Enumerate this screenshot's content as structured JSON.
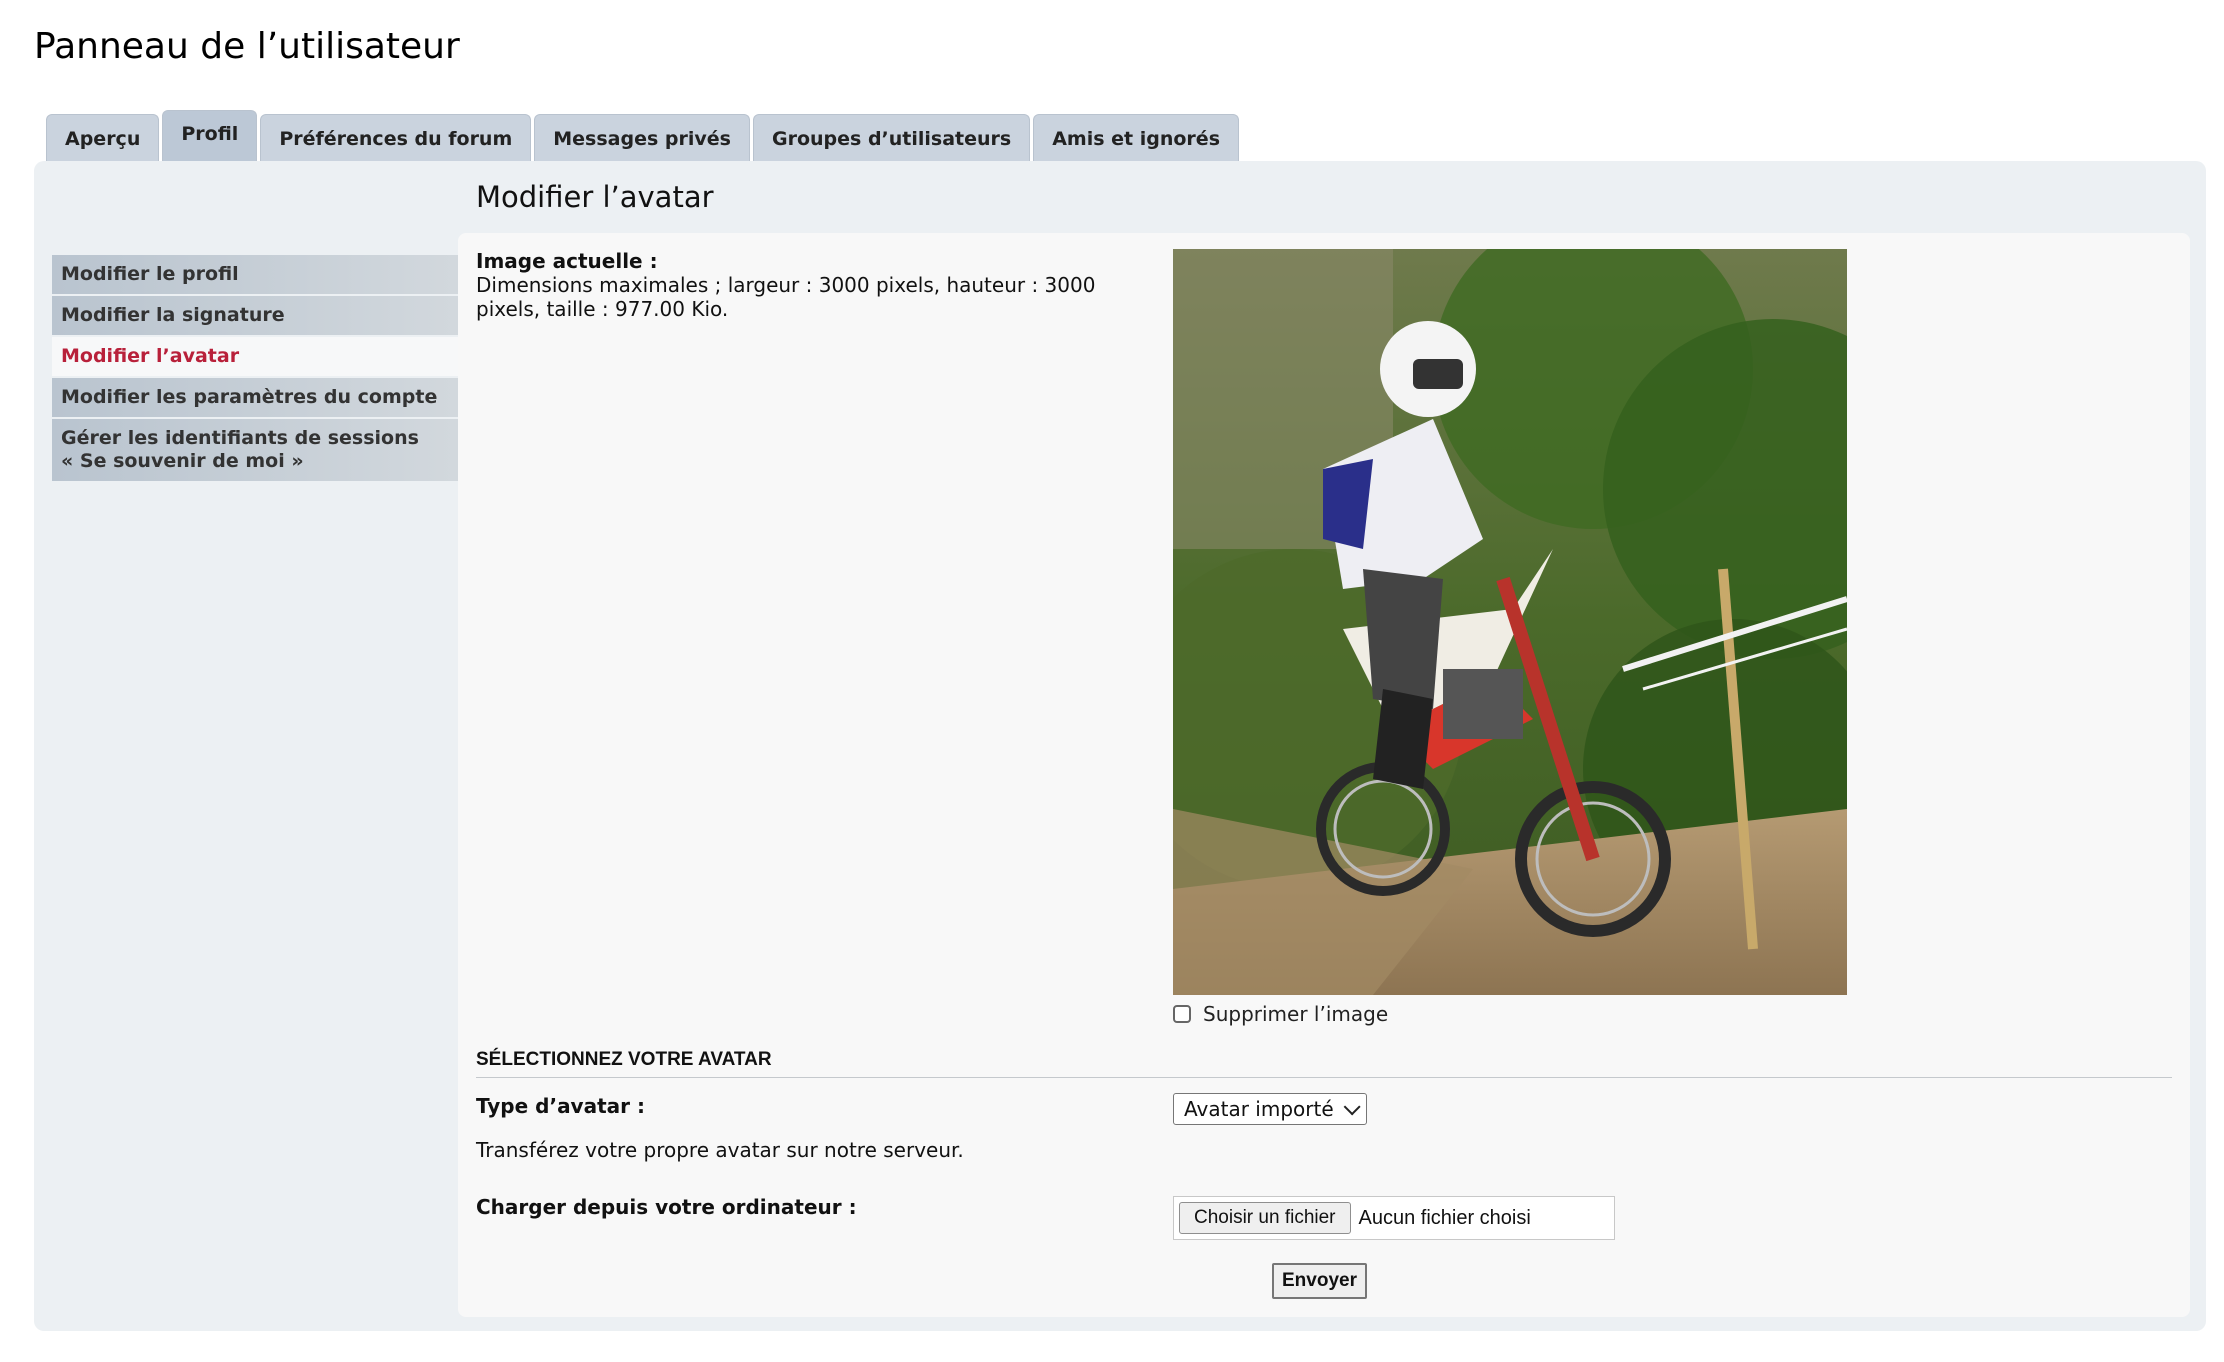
{
  "page": {
    "title": "Panneau de l’utilisateur"
  },
  "tabs": [
    {
      "label": "Aperçu"
    },
    {
      "label": "Profil"
    },
    {
      "label": "Préférences du forum"
    },
    {
      "label": "Messages privés"
    },
    {
      "label": "Groupes d’utilisateurs"
    },
    {
      "label": "Amis et ignorés"
    }
  ],
  "side_menu": [
    {
      "label": "Modifier le profil"
    },
    {
      "label": "Modifier la signature"
    },
    {
      "label": "Modifier l’avatar"
    },
    {
      "label": "Modifier les paramètres du compte"
    },
    {
      "label": "Gérer les identifiants de sessions",
      "label2": "« Se souvenir de moi »"
    }
  ],
  "section": {
    "title": "Modifier l’avatar"
  },
  "current_image": {
    "label": "Image actuelle :",
    "constraints": "Dimensions maximales ; largeur : 3000 pixels, hauteur : 3000 pixels, taille : 977.00 Kio."
  },
  "delete_image": {
    "label": "Supprimer l’image"
  },
  "select_avatar": {
    "legend": "SÉLECTIONNEZ VOTRE AVATAR",
    "type_label": "Type d’avatar :",
    "type_value": "Avatar importé",
    "description": "Transférez votre propre avatar sur notre serveur.",
    "upload_label": "Charger depuis votre ordinateur :",
    "file_button": "Choisir un fichier",
    "file_status": "Aucun fichier choisi"
  },
  "submit": {
    "label": "Envoyer"
  },
  "colors": {
    "active_menu_text": "#b8203a",
    "panel_bg": "#ecf0f3",
    "tab_bg": "#cad3de"
  }
}
